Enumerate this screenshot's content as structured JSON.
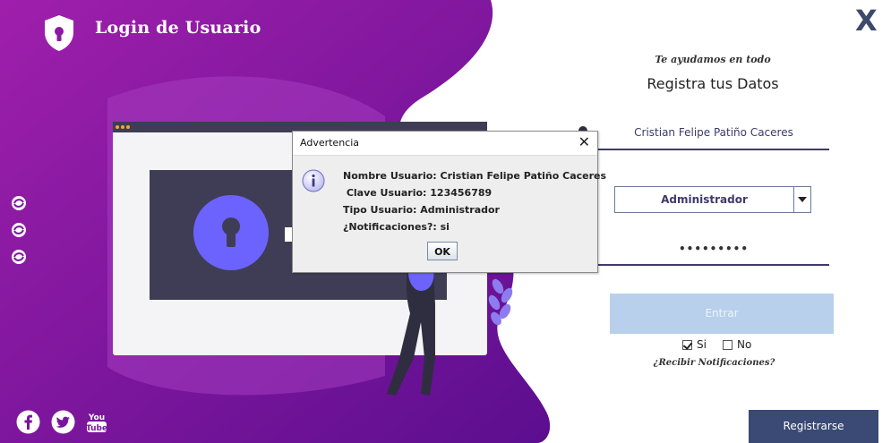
{
  "window": {
    "title": "Login de Usuario",
    "close_label": "X"
  },
  "form": {
    "tagline": "Te ayudamos en todo",
    "heading": "Registra tus Datos",
    "name_value": "Cristian Felipe Patiño Caceres",
    "user_type_selected": "Administrador",
    "password_masked": "•••••••••",
    "enter_label": "Entrar",
    "checkbox_yes_label": "Si",
    "checkbox_yes_checked": true,
    "checkbox_no_label": "No",
    "checkbox_no_checked": false,
    "notifications_label": "¿Recibir Notificaciones?",
    "register_label": "Registrarse"
  },
  "dialog": {
    "title": "Advertencia",
    "close_symbol": "✕",
    "lines": [
      "Nombre Usuario: Cristian Felipe Patiño Caceres",
      " Clave Usuario: 123456789",
      "Tipo Usuario: Administrador",
      "¿Notificaciones?: si"
    ],
    "ok_label": "OK"
  },
  "icons": [
    "shield-lock-icon",
    "facebook-icon",
    "twitter-icon",
    "youtube-icon",
    "swirl-icon",
    "info-icon",
    "dropdown-arrow-icon"
  ],
  "colors": {
    "purple_gradient_start": "#9a1fa8",
    "purple_gradient_end": "#5a0d8c",
    "accent_blue": "#3b4a75",
    "lock_circle": "#6c63ff",
    "enter_button": "#b8d0ec"
  }
}
